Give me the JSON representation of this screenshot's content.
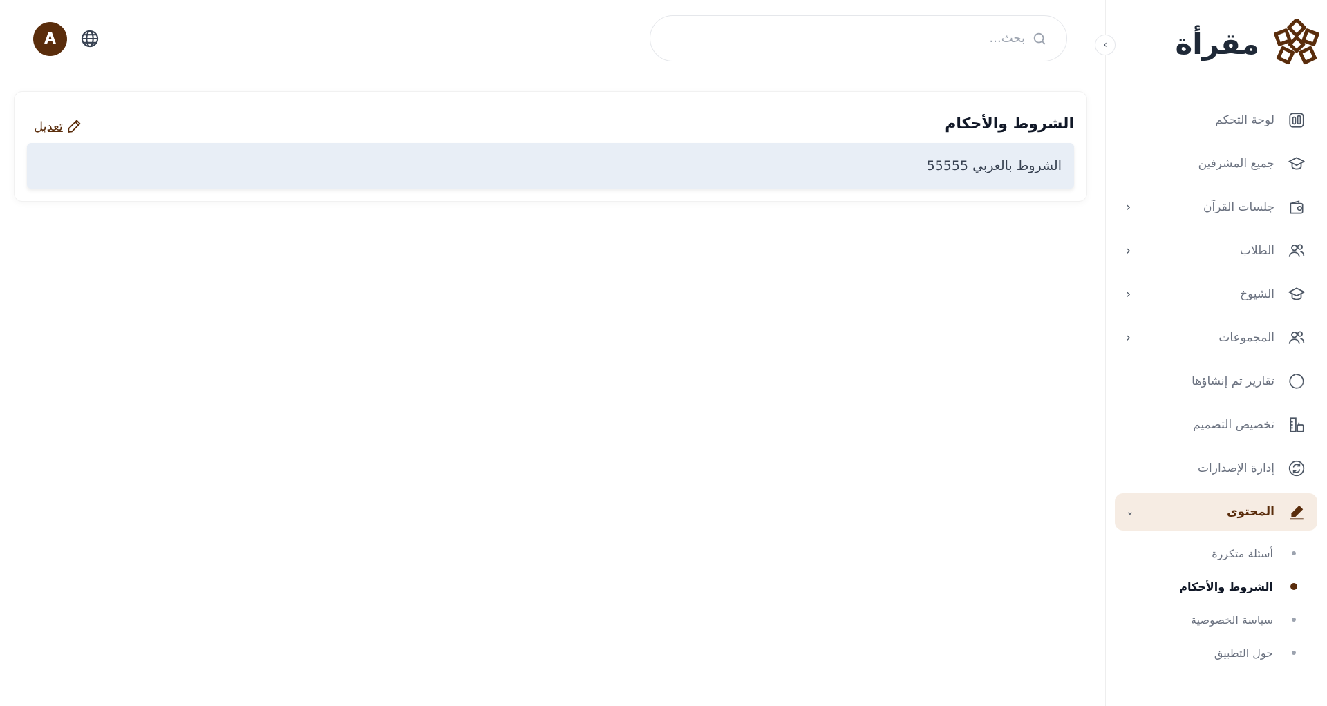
{
  "app": {
    "name": "مقرأة"
  },
  "header": {
    "search_placeholder": "بحث...",
    "avatar_initial": "A",
    "icons": {
      "language": "globe-icon",
      "search": "search-icon"
    }
  },
  "sidebar": {
    "collapse_icon": "chevron-right-icon",
    "items": [
      {
        "label": "لوحة التحكم",
        "icon": "dashboard-icon",
        "has_children": false
      },
      {
        "label": "جميع المشرفين",
        "icon": "graduation-cap-icon",
        "has_children": false
      },
      {
        "label": "جلسات القرآن",
        "icon": "wallet-icon",
        "has_children": true
      },
      {
        "label": "الطلاب",
        "icon": "users-icon",
        "has_children": true
      },
      {
        "label": "الشيوخ",
        "icon": "graduation-cap-icon",
        "has_children": true
      },
      {
        "label": "المجموعات",
        "icon": "users-icon",
        "has_children": true
      },
      {
        "label": "تقارير تم إنشاؤها",
        "icon": "loader-circle-icon",
        "has_children": false
      },
      {
        "label": "تخصيص التصميم",
        "icon": "design-icon",
        "has_children": false
      },
      {
        "label": "إدارة الإصدارات",
        "icon": "refresh-icon",
        "has_children": false
      },
      {
        "label": "المحتوى",
        "icon": "pen-icon",
        "has_children": true,
        "active": true
      }
    ],
    "content_submenu": [
      {
        "label": "أسئلة متكررة"
      },
      {
        "label": "الشروط والأحكام",
        "current": true
      },
      {
        "label": "سياسة الخصوصية"
      },
      {
        "label": "حول التطبيق"
      }
    ]
  },
  "main": {
    "card_title": "الشروط والأحكام",
    "edit_label": "تعديل",
    "content_text": "الشروط بالعربي 55555"
  },
  "colors": {
    "brand": "#5a2d0c",
    "active_bg": "#f6ece3",
    "content_bg": "#e8eef6"
  }
}
